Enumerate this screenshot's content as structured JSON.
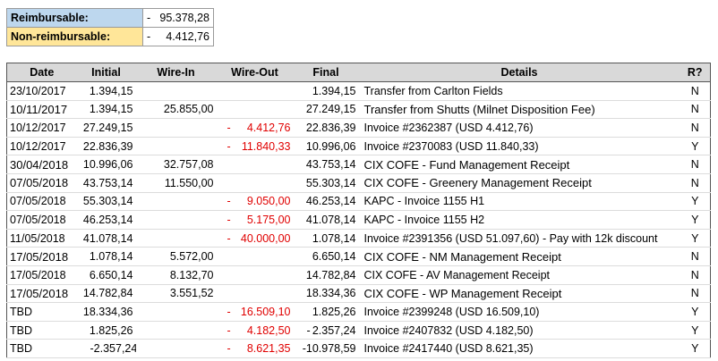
{
  "summary": {
    "reimbursable_label": "Reimbursable:",
    "reimbursable_sign": "-",
    "reimbursable_value": "95.378,28",
    "non_reimbursable_label": "Non-reimbursable:",
    "non_reimbursable_sign": "-",
    "non_reimbursable_value": "4.412,76"
  },
  "table": {
    "headers": [
      "Date",
      "Initial",
      "Wire-In",
      "Wire-Out",
      "Final",
      "Details",
      "R?"
    ],
    "rows": [
      {
        "date": "23/10/2017",
        "initial": "1.394,15",
        "wire_in": "",
        "wire_out": "",
        "final": "1.394,15",
        "details": "Transfer from Carlton Fields",
        "r": "N"
      },
      {
        "date": "10/11/2017",
        "initial": "1.394,15",
        "wire_in": "25.855,00",
        "wire_out": "",
        "final": "27.249,15",
        "details": "Transfer from Shutts (Milnet Disposition Fee)",
        "r": "N"
      },
      {
        "date": "10/12/2017",
        "initial": "27.249,15",
        "wire_in": "",
        "wire_out": "4.412,76",
        "final": "22.836,39",
        "details": "Invoice #2362387 (USD 4.412,76)",
        "r": "N"
      },
      {
        "date": "10/12/2017",
        "initial": "22.836,39",
        "wire_in": "",
        "wire_out": "11.840,33",
        "final": "10.996,06",
        "details": "Invoice #2370083 (USD 11.840,33)",
        "r": "Y"
      },
      {
        "date": "30/04/2018",
        "initial": "10.996,06",
        "wire_in": "32.757,08",
        "wire_out": "",
        "final": "43.753,14",
        "details": "CIX COFE - Fund Management Receipt",
        "r": "N"
      },
      {
        "date": "07/05/2018",
        "initial": "43.753,14",
        "wire_in": "11.550,00",
        "wire_out": "",
        "final": "55.303,14",
        "details": "CIX COFE - Greenery Management Receipt",
        "r": "N"
      },
      {
        "date": "07/05/2018",
        "initial": "55.303,14",
        "wire_in": "",
        "wire_out": "9.050,00",
        "final": "46.253,14",
        "details": "KAPC - Invoice 1155 H1",
        "r": "Y"
      },
      {
        "date": "07/05/2018",
        "initial": "46.253,14",
        "wire_in": "",
        "wire_out": "5.175,00",
        "final": "41.078,14",
        "details": "KAPC - Invoice 1155 H2",
        "r": "Y"
      },
      {
        "date": "11/05/2018",
        "initial": "41.078,14",
        "wire_in": "",
        "wire_out": "40.000,00",
        "final": "1.078,14",
        "details": "Invoice #2391356 (USD 51.097,60) - Pay with 12k discount",
        "r": "Y"
      },
      {
        "date": "17/05/2018",
        "initial": "1.078,14",
        "wire_in": "5.572,00",
        "wire_out": "",
        "final": "6.650,14",
        "details": "CIX COFE - NM Management Receipt",
        "r": "N"
      },
      {
        "date": "17/05/2018",
        "initial": "6.650,14",
        "wire_in": "8.132,70",
        "wire_out": "",
        "final": "14.782,84",
        "details": "CIX COFE - AV Management Receipt",
        "r": "N"
      },
      {
        "date": "17/05/2018",
        "initial": "14.782,84",
        "wire_in": "3.551,52",
        "wire_out": "",
        "final": "18.334,36",
        "details": "CIX COFE - WP Management Receipt",
        "r": "N"
      },
      {
        "date": "TBD",
        "initial": "18.334,36",
        "wire_in": "",
        "wire_out": "16.509,10",
        "final": "1.825,26",
        "details": "Invoice #2399248 (USD 16.509,10)",
        "r": "Y"
      },
      {
        "date": "TBD",
        "initial": "1.825,26",
        "wire_in": "",
        "wire_out": "4.182,50",
        "final": "2.357,24",
        "final_sign": "-",
        "details": "Invoice #2407832 (USD 4.182,50)",
        "r": "Y"
      },
      {
        "date": "TBD",
        "initial": "2.357,24",
        "initial_sign": "-",
        "wire_in": "",
        "wire_out": "8.621,35",
        "final": "-10.978,59",
        "details": "Invoice #2417440 (USD 8.621,35)",
        "r": "Y"
      }
    ]
  },
  "colors": {
    "reimbursable_bg": "#bdd7ee",
    "non_reimbursable_bg": "#ffe699",
    "header_bg": "#d9d9d9",
    "wire_out_text": "#e00000"
  }
}
